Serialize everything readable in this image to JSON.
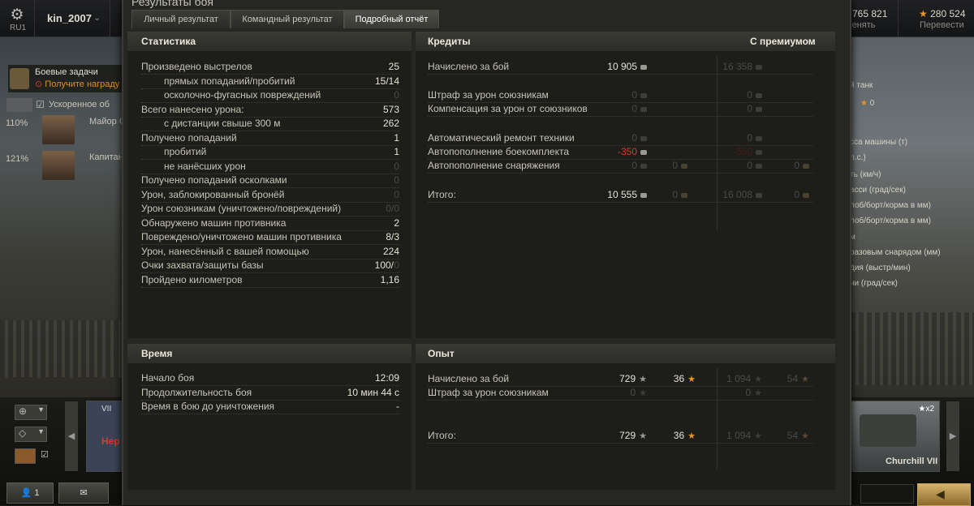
{
  "topbar": {
    "region": "RU1",
    "username": "kin_2007",
    "silver_value": "765 821",
    "silver_label": "менять",
    "gold_value": "280 524",
    "gold_label": "Перевести"
  },
  "left_panel": {
    "missions_title": "Боевые задачи",
    "missions_sub": "Получите награду за в",
    "accel_label": "Ускоренное об",
    "crew": [
      {
        "pct": "110%",
        "name": "Майор С"
      },
      {
        "pct": "121%",
        "name": "Капитан"
      }
    ]
  },
  "right_panel": {
    "lines": [
      "й танк",
      "0",
      "сса машины (т)",
      "л.с.)",
      "ть (км/ч)",
      "асси (град/сек)",
      "лоб/борт/корма в мм)",
      "лоб/борт/корма в мм)",
      "м",
      "разовым снарядом (мм)",
      "дия (выстр/мин)",
      "ни (град/сек)"
    ],
    "vehicle_name": "Churchill VII",
    "vehicle_mult": "x2"
  },
  "bottom": {
    "players_count": "1",
    "carousel_tag": "VII",
    "carousel_red": "Нер"
  },
  "dialog": {
    "title": "Результаты боя",
    "tabs": [
      "Личный результат",
      "Командный результат",
      "Подробный отчёт"
    ],
    "active_tab": 2,
    "stats": {
      "header": "Статистика",
      "rows": [
        {
          "label": "Произведено выстрелов",
          "value": "25",
          "indent": false,
          "dim": false
        },
        {
          "label": "прямых попаданий/пробитий",
          "value": "15/14",
          "indent": true,
          "dim": false
        },
        {
          "label": "осколочно-фугасных повреждений",
          "value": "0",
          "indent": true,
          "dim": true
        },
        {
          "label": "Всего нанесено урона:",
          "value": "573",
          "indent": false,
          "dim": false
        },
        {
          "label": "с дистанции свыше 300 м",
          "value": "262",
          "indent": true,
          "dim": false
        },
        {
          "label": "Получено попаданий",
          "value": "1",
          "indent": false,
          "dim": false
        },
        {
          "label": "пробитий",
          "value": "1",
          "indent": true,
          "dim": false
        },
        {
          "label": "не нанёсших урон",
          "value": "0",
          "indent": true,
          "dim": true
        },
        {
          "label": "Получено попаданий осколками",
          "value": "0",
          "indent": false,
          "dim": true
        },
        {
          "label": "Урон, заблокированный бронёй",
          "value": "0",
          "indent": false,
          "dim": true
        },
        {
          "label": "Урон союзникам (уничтожено/повреждений)",
          "value": "0/0",
          "indent": false,
          "dim": true
        },
        {
          "label": "Обнаружено машин противника",
          "value": "2",
          "indent": false,
          "dim": false
        },
        {
          "label": "Повреждено/уничтожено машин противника",
          "value": "8/3",
          "indent": false,
          "dim": false
        },
        {
          "label": "Урон, нанесённый с вашей помощью",
          "value": "224",
          "indent": false,
          "dim": false
        },
        {
          "label": "Очки захвата/защиты базы",
          "value": "100/",
          "value_dim": "0",
          "indent": false,
          "dim": false
        },
        {
          "label": "Пройдено километров",
          "value": "1,16",
          "indent": false,
          "dim": false
        }
      ]
    },
    "credits": {
      "header": "Кредиты",
      "premium_header": "С премиумом",
      "rows": [
        {
          "label": "Начислено за бой",
          "c1": "10 905",
          "g1": "",
          "c2": "16 358",
          "g2": ""
        },
        {
          "label": "Штраф за урон союзникам",
          "c1": "0",
          "g1": "",
          "c2": "0",
          "g2": ""
        },
        {
          "label": "Компенсация за урон от союзников",
          "c1": "0",
          "g1": "",
          "c2": "0",
          "g2": ""
        },
        {
          "label": "Автоматический ремонт техники",
          "c1": "0",
          "g1": "",
          "c2": "0",
          "g2": ""
        },
        {
          "label": "Автопополнение боекомплекта",
          "c1": "-350",
          "g1": "",
          "c2": "-350",
          "g2": ""
        },
        {
          "label": "Автопополнение снаряжения",
          "c1": "0",
          "g1": "0",
          "c2": "0",
          "g2": "0"
        },
        {
          "label": "Итого:",
          "c1": "10 555",
          "g1": "0",
          "c2": "16 008",
          "g2": "0"
        }
      ]
    },
    "time": {
      "header": "Время",
      "rows": [
        {
          "label": "Начало боя",
          "value": "12:09"
        },
        {
          "label": "Продолжительность боя",
          "value": "10 мин 44 с"
        },
        {
          "label": "Время в бою до уничтожения",
          "value": "-"
        }
      ]
    },
    "exp": {
      "header": "Опыт",
      "rows": [
        {
          "label": "Начислено за бой",
          "x1": "729",
          "f1": "36",
          "x2": "1 094",
          "f2": "54"
        },
        {
          "label": "Штраф за урон союзникам",
          "x1": "0",
          "f1": "",
          "x2": "0",
          "f2": ""
        },
        {
          "label": "Итого:",
          "x1": "729",
          "f1": "36",
          "x2": "1 094",
          "f2": "54"
        }
      ]
    }
  }
}
